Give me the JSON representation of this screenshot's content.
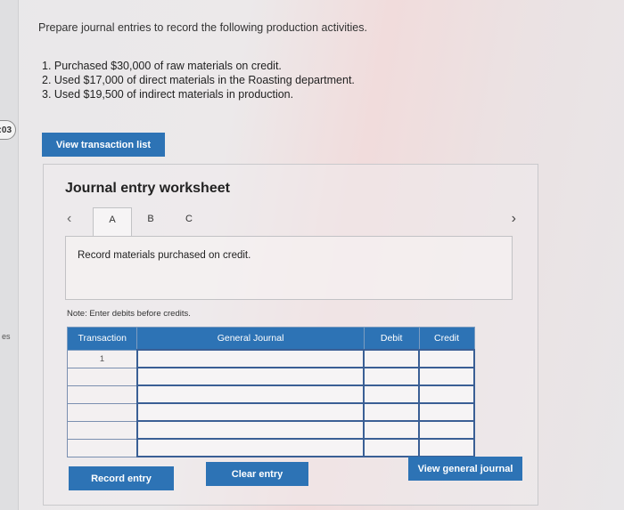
{
  "prompt": "Prepare journal entries to record the following production activities.",
  "steps": [
    "1. Purchased $30,000 of raw materials on credit.",
    "2. Used $17,000 of direct materials in the Roasting department.",
    "3. Used $19,500 of indirect materials in production."
  ],
  "timer": ":03",
  "side_fragment": "es",
  "view_transaction_label": "View transaction list",
  "worksheet": {
    "title": "Journal entry worksheet",
    "tabs": [
      "A",
      "B",
      "C"
    ],
    "active_tab": "A",
    "description": "Record materials purchased on credit.",
    "note": "Note: Enter debits before credits.",
    "columns": [
      "Transaction",
      "General Journal",
      "Debit",
      "Credit"
    ],
    "rows": [
      {
        "transaction": "1"
      },
      {
        "transaction": ""
      },
      {
        "transaction": ""
      },
      {
        "transaction": ""
      },
      {
        "transaction": ""
      },
      {
        "transaction": ""
      }
    ]
  },
  "buttons": {
    "record": "Record entry",
    "clear": "Clear entry",
    "view_general_journal": "View general journal"
  },
  "colors": {
    "accent": "#2d73b5"
  }
}
